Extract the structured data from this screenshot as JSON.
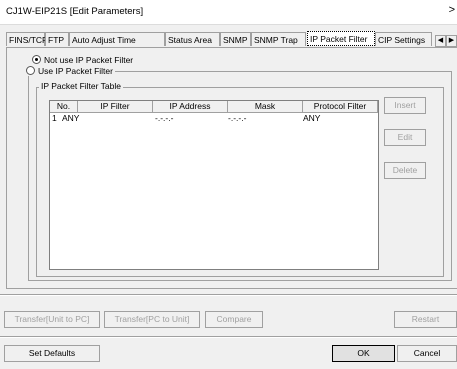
{
  "window": {
    "title": "CJ1W-EIP21S [Edit Parameters]",
    "close_glyph": ">"
  },
  "tabs": [
    "FINS/TCP",
    "FTP",
    "Auto Adjust Time",
    "Status Area",
    "SNMP",
    "SNMP Trap",
    "IP Packet Filter",
    "CIP Settings"
  ],
  "selected_tab": "IP Packet Filter",
  "tab_scroll": {
    "left": "◀",
    "right": "▶"
  },
  "radios": {
    "not_use": "Not use IP Packet Filter",
    "use": "Use IP Packet Filter",
    "selected": "not_use"
  },
  "group_label": "IP Packet Filter Table",
  "table": {
    "headers": [
      "No.",
      "IP Filter",
      "IP Address",
      "Mask",
      "Protocol Filter"
    ],
    "rows": [
      {
        "no": "1",
        "ip_filter": "ANY",
        "ip_address": "-.-.-.-",
        "mask": "-.-.-.-",
        "protocol": "ANY"
      }
    ]
  },
  "side_buttons": {
    "insert": "Insert",
    "edit": "Edit",
    "delete": "Delete"
  },
  "transfer_buttons": {
    "unit_to_pc": "Transfer[Unit to PC]",
    "pc_to_unit": "Transfer[PC to Unit]",
    "compare": "Compare",
    "restart": "Restart"
  },
  "bottom_buttons": {
    "set_defaults": "Set Defaults",
    "ok": "OK",
    "cancel": "Cancel"
  }
}
